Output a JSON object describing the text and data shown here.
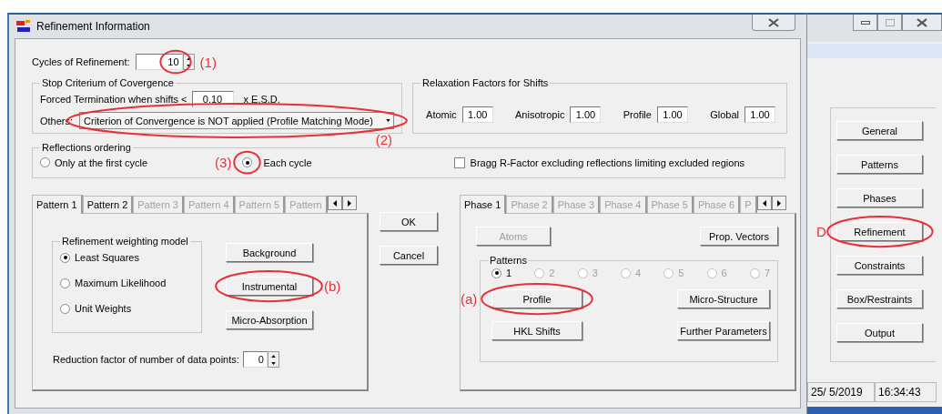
{
  "window": {
    "title": "Refinement Information"
  },
  "cycles": {
    "label": "Cycles of Refinement:",
    "value": "10",
    "circled": true,
    "annotation": "(1)"
  },
  "stop_criterium": {
    "title": "Stop Criterium of Covergence",
    "forced_label": "Forced Termination when  shifts <",
    "shift_value": "0.10",
    "esd_label": "x  E.S.D.",
    "others_label": "Others:",
    "others_value": "Criterion of Convergence is NOT applied (Profile Matching Mode)",
    "circled": true,
    "annotation": "(2)"
  },
  "relaxation": {
    "title": "Relaxation Factors for Shifts",
    "factors": [
      {
        "label": "Atomic",
        "value": "1.00"
      },
      {
        "label": "Anisotropic",
        "value": "1.00"
      },
      {
        "label": "Profile",
        "value": "1.00"
      },
      {
        "label": "Global",
        "value": "1.00"
      }
    ]
  },
  "reflections": {
    "title": "Reflections ordering",
    "options": [
      {
        "label": "Only at the first cycle",
        "selected": false
      },
      {
        "label": "Each cycle",
        "selected": true,
        "circled": true,
        "annotation": "(3)"
      }
    ],
    "bragg": {
      "label": "Bragg R-Factor excluding  reflections limiting excluded regions",
      "checked": false
    }
  },
  "pattern_tabs": [
    {
      "label": "Pattern 1",
      "selected": true,
      "disabled": false
    },
    {
      "label": "Pattern 2",
      "selected": false,
      "disabled": false
    },
    {
      "label": "Pattern 3",
      "selected": false,
      "disabled": true
    },
    {
      "label": "Pattern 4",
      "selected": false,
      "disabled": true
    },
    {
      "label": "Pattern 5",
      "selected": false,
      "disabled": true
    },
    {
      "label": "Pattern",
      "selected": false,
      "disabled": true
    }
  ],
  "weighting": {
    "title": "Refinement weighting model",
    "options": [
      {
        "label": "Least Squares",
        "selected": true
      },
      {
        "label": "Maximum Likelihood",
        "selected": false
      },
      {
        "label": "Unit Weights",
        "selected": false
      }
    ]
  },
  "pattern_buttons": [
    {
      "label": "Background",
      "circled": false
    },
    {
      "label": "Instrumental",
      "circled": true,
      "annotation": "(b)"
    },
    {
      "label": "Micro-Absorption",
      "circled": false
    }
  ],
  "reduction": {
    "label": "Reduction factor of number of data points:",
    "value": "0"
  },
  "dialog_buttons": [
    "OK",
    "Cancel"
  ],
  "phase_tabs": [
    {
      "label": "Phase 1",
      "selected": true,
      "disabled": false
    },
    {
      "label": "Phase 2",
      "selected": false,
      "disabled": true
    },
    {
      "label": "Phase 3",
      "selected": false,
      "disabled": true
    },
    {
      "label": "Phase 4",
      "selected": false,
      "disabled": true
    },
    {
      "label": "Phase 5",
      "selected": false,
      "disabled": true
    },
    {
      "label": "Phase 6",
      "selected": false,
      "disabled": true
    },
    {
      "label": "P",
      "selected": false,
      "disabled": true
    }
  ],
  "phase_top_buttons": [
    {
      "label": "Atoms",
      "disabled": true
    },
    {
      "label": "Prop. Vectors",
      "disabled": false
    }
  ],
  "patterns": {
    "title": "Patterns",
    "options": [
      {
        "label": "1",
        "selected": true,
        "disabled": false
      },
      {
        "label": "2",
        "selected": false,
        "disabled": true
      },
      {
        "label": "3",
        "selected": false,
        "disabled": true
      },
      {
        "label": "4",
        "selected": false,
        "disabled": true
      },
      {
        "label": "5",
        "selected": false,
        "disabled": true
      },
      {
        "label": "6",
        "selected": false,
        "disabled": true
      },
      {
        "label": "7",
        "selected": false,
        "disabled": true
      }
    ],
    "buttons": [
      {
        "label": "Profile",
        "circled": true,
        "annotation": "(a)"
      },
      {
        "label": "Micro-Structure",
        "circled": false
      },
      {
        "label": "HKL Shifts",
        "circled": false
      },
      {
        "label": "Further Parameters",
        "circled": false
      }
    ]
  },
  "side_window": {
    "buttons": [
      {
        "label": "General",
        "circled": false
      },
      {
        "label": "Patterns",
        "circled": false
      },
      {
        "label": "Phases",
        "circled": false
      },
      {
        "label": "Refinement",
        "circled": true,
        "annotation": "D"
      },
      {
        "label": "Constraints",
        "circled": false
      },
      {
        "label": "Box/Restraints",
        "circled": false
      },
      {
        "label": "Output",
        "circled": false
      }
    ],
    "status": [
      "25/ 5/2019",
      "16:34:43"
    ]
  }
}
